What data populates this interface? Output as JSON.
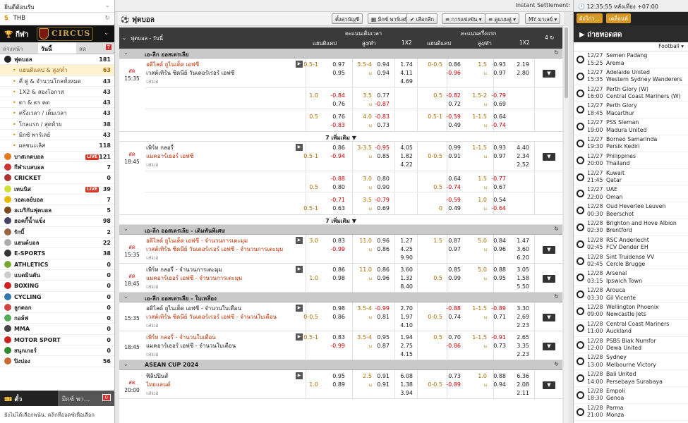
{
  "left": {
    "welcome": "ยินดีต้อนรับ",
    "currency": "THB",
    "sport_title": "กีฬา",
    "logo": "CIRCUS",
    "tabs": [
      {
        "label": "ล่วงหน้า"
      },
      {
        "label": "วันนี้"
      },
      {
        "label": "สด",
        "badge": "7"
      }
    ],
    "sports": [
      {
        "label": "ฟุตบอล",
        "count": "181",
        "color": "#222"
      },
      {
        "label": "แฮนดิแคป & สูง/ต่ำ",
        "count": "63",
        "sub": true,
        "sel": true
      },
      {
        "label": "คี่ คู่ & จำนวนโกลทั้งหมด",
        "count": "43",
        "sub": true
      },
      {
        "label": "1X2 & สองโอกาส",
        "count": "43",
        "sub": true
      },
      {
        "label": "ตา & ตร คด",
        "count": "43",
        "sub": true
      },
      {
        "label": "ครึ่งเวลา / เต็มเวลา",
        "count": "43",
        "sub": true
      },
      {
        "label": "โกลแรก / สุดท้าย",
        "count": "38",
        "sub": true
      },
      {
        "label": "มิกซ์ พาร์เลย์",
        "count": "43",
        "sub": true
      },
      {
        "label": "ผลชนะเลิศ",
        "count": "118",
        "sub": true
      },
      {
        "label": "บาสเกตบอล",
        "count": "121",
        "live": "LIVE",
        "color": "#e07b20"
      },
      {
        "label": "กีฬาเบสบอล",
        "count": "7",
        "color": "#c33"
      },
      {
        "label": "CRICKET",
        "count": "0",
        "color": "#a33"
      },
      {
        "label": "เทนนิส",
        "count": "39",
        "live": "LIVE",
        "color": "#cfe03a"
      },
      {
        "label": "วอลเลย์บอล",
        "count": "7",
        "color": "#e6b800"
      },
      {
        "label": "อเมริกันฟุตบอล",
        "count": "5",
        "color": "#7a4a20"
      },
      {
        "label": "ฮอคกี้น้ำแข็ง",
        "count": "98",
        "color": "#446"
      },
      {
        "label": "รักบี้",
        "count": "2",
        "color": "#964"
      },
      {
        "label": "แฮนด์บอล",
        "count": "22",
        "color": "#aaa"
      },
      {
        "label": "E-SPORTS",
        "count": "38",
        "color": "#333"
      },
      {
        "label": "ATHLETICS",
        "count": "0",
        "color": "#7a3"
      },
      {
        "label": "แบดมินตัน",
        "count": "0",
        "color": "#ccc"
      },
      {
        "label": "BOXING",
        "count": "0",
        "color": "#c22"
      },
      {
        "label": "CYCLING",
        "count": "0",
        "color": "#37a"
      },
      {
        "label": "ลูกดอก",
        "count": "0",
        "color": "#c44"
      },
      {
        "label": "กอล์ฟ",
        "count": "0",
        "color": "#5a5"
      },
      {
        "label": "MMA",
        "count": "0",
        "color": "#444"
      },
      {
        "label": "MOTOR SPORT",
        "count": "0",
        "color": "#c22"
      },
      {
        "label": "สนุกเกอร์",
        "count": "0",
        "color": "#383"
      },
      {
        "label": "ปิงปอง",
        "count": "56",
        "color": "#c63"
      }
    ],
    "bets_tab": "ตั๋ว",
    "mix_tab": "มิกซ์ พา...",
    "mix_badge": "0",
    "hint": "ยังไม่ได้เลือกพนัน. คลิกที่ออดซ์เพื่อเลือก"
  },
  "main": {
    "instant": "Instant Settlement:",
    "title": "ฟุตบอล",
    "tools": [
      "ตั้งค่าบัญชี",
      "มิกซ์ พาร์เลย์",
      "เลือกลีก",
      "การแข่งขัน",
      "ดูแบบคู่",
      "มาเลย์"
    ],
    "head": {
      "left": "ฟุตบอล - วันนี้",
      "full": "คะแนนเต็มเวลา",
      "half": "คะแนนครึ่งแรก",
      "hdp": "แฮนดิแคป",
      "ou": "สูง/ต่ำ",
      "x12": "1X2",
      "count": "4"
    },
    "leagues": [
      {
        "name": "เอ-ลีก ออสเตรเลีย",
        "matches": [
          {
            "live": "สด",
            "time": "15:35",
            "home": "อดิไลด์ ยูไนเต็ด เอฟซี",
            "away": "เวสต์เทิร์น ซิดนีย์ วันเดอร์เรอร์ เอฟซี",
            "draw": "เสมอ",
            "rows": [
              [
                "0.5-1",
                "0.97",
                "3.5-4",
                "0.94",
                "1.74",
                "0-0.5",
                "0.86",
                "1.5",
                "0.93",
                "2.19"
              ],
              [
                "",
                "0.95",
                "u",
                "0.94",
                "4.11",
                "",
                "-0.96",
                "u",
                "0.97",
                "2.80"
              ],
              [
                "",
                "",
                "",
                "",
                "4.69",
                "",
                "",
                "",
                "",
                ""
              ]
            ],
            "alt": [
              [
                "1.0",
                "-0.84",
                "3.5",
                "0.77",
                "",
                "0.5",
                "-0.82",
                "1.5-2",
                "-0.79",
                ""
              ],
              [
                "",
                "0.76",
                "u",
                "-0.87",
                "",
                "",
                "0.72",
                "u",
                "0.69",
                ""
              ],
              [
                "0.5",
                "0.76",
                "4.0",
                "-0.83",
                "",
                "0.5-1",
                "-0.59",
                "1-1.5",
                "0.64",
                ""
              ],
              [
                "",
                "-0.83",
                "u",
                "0.73",
                "",
                "",
                "0.49",
                "u",
                "-0.74",
                ""
              ]
            ],
            "more": "7 เพิ่มเติม"
          },
          {
            "live": "สด",
            "time": "18:45",
            "home": "เพิร์ท กลอรี่",
            "away": "แมคอาร์เธอร์ เอฟซี",
            "draw": "เสมอ",
            "awayfav": true,
            "rows": [
              [
                "",
                "0.86",
                "3-3.5",
                "-0.95",
                "4.05",
                "",
                "0.99",
                "1-1.5",
                "0.93",
                "4.40"
              ],
              [
                "0.5-1",
                "-0.94",
                "u",
                "0.85",
                "1.82",
                "0-0.5",
                "0.91",
                "u",
                "0.97",
                "2.34"
              ],
              [
                "",
                "",
                "",
                "",
                "4.22",
                "",
                "",
                "",
                "",
                "2.52"
              ]
            ],
            "alt": [
              [
                "",
                "-0.88",
                "3.0",
                "0.80",
                "",
                "",
                "0.64",
                "1.5",
                "-0.77",
                ""
              ],
              [
                "0.5",
                "0.80",
                "u",
                "0.90",
                "",
                "0.5",
                "-0.74",
                "u",
                "0.67",
                ""
              ],
              [
                "",
                "-0.71",
                "3.5",
                "-0.79",
                "",
                "",
                "-0.59",
                "1.0",
                "0.54",
                ""
              ],
              [
                "0.5-1",
                "0.63",
                "u",
                "0.69",
                "",
                "0",
                "0.49",
                "u",
                "-0.64",
                ""
              ]
            ],
            "more": "7 เพิ่มเติม"
          }
        ]
      },
      {
        "name": "เอ-ลีก ออสเตรเลีย - เดิมพันพิเศษ",
        "matches": [
          {
            "live": "สด",
            "time": "15:35",
            "home": "อดิไลด์ ยูไนเต็ด เอฟซี - จำนวนการเตะมุม",
            "away": "เวสต์เทิร์น ซิดนีย์ วันเดอร์เรอร์ เอฟซี - จำนวนการเตะมุม",
            "draw": "เสมอ",
            "bothfav": true,
            "rows": [
              [
                "3.0",
                "0.83",
                "11.0",
                "0.96",
                "1.27",
                "1.5",
                "0.87",
                "5.0",
                "0.84",
                "1.47"
              ],
              [
                "",
                "-0.99",
                "u",
                "0.86",
                "4.25",
                "",
                "0.97",
                "u",
                "0.96",
                "3.60"
              ],
              [
                "",
                "",
                "",
                "",
                "9.90",
                "",
                "",
                "",
                "",
                "6.20"
              ]
            ],
            "alt": []
          },
          {
            "live": "สด",
            "time": "18:45",
            "home": "เพิร์ท กลอรี่ - จำนวนการเตะมุม",
            "away": "แมคอาร์เธอร์ เอฟซี - จำนวนการเตะมุม",
            "draw": "เสมอ",
            "awayfav": true,
            "rows": [
              [
                "",
                "0.86",
                "11.0",
                "0.86",
                "3.60",
                "",
                "0.85",
                "5.0",
                "0.88",
                "3.05"
              ],
              [
                "1.0",
                "0.98",
                "u",
                "0.96",
                "1.32",
                "0.5",
                "0.99",
                "u",
                "0.95",
                "1.58"
              ],
              [
                "",
                "",
                "",
                "",
                "8.40",
                "",
                "",
                "",
                "",
                "5.50"
              ]
            ],
            "alt": []
          }
        ]
      },
      {
        "name": "เอ-ลีก ออสเตรเลีย - ใบเหลือง",
        "matches": [
          {
            "live": "",
            "time": "15:35",
            "home": "อดิไลด์ ยูไนเต็ด เอฟซี - จำนวนใบเตือน",
            "away": "เวสต์เทิร์น ซิดนีย์ วันเดอร์เรอร์ เอฟซี - จำนวนใบเตือน",
            "draw": "เสมอ",
            "awayfav": true,
            "rows": [
              [
                "",
                "0.98",
                "3.5-4",
                "-0.99",
                "2.70",
                "",
                "-0.88",
                "1-1.5",
                "-0.89",
                "3.30"
              ],
              [
                "0-0.5",
                "0.86",
                "u",
                "0.81",
                "1.97",
                "0-0.5",
                "0.74",
                "u",
                "0.71",
                "2.69"
              ],
              [
                "",
                "",
                "",
                "",
                "4.10",
                "",
                "",
                "",
                "",
                "2.23"
              ]
            ],
            "alt": []
          },
          {
            "live": "",
            "time": "18:45",
            "home": "เพิร์ท กลอรี่ - จำนวนใบเตือน",
            "away": "แมคอาร์เธอร์ เอฟซี - จำนวนใบเตือน",
            "draw": "เสมอ",
            "homefav": true,
            "rows": [
              [
                "0.5-1",
                "0.83",
                "3.5-4",
                "0.95",
                "1.94",
                "0.5",
                "0.70",
                "1-1.5",
                "-0.91",
                "2.65"
              ],
              [
                "",
                "-0.99",
                "u",
                "0.87",
                "2.75",
                "",
                "-0.86",
                "u",
                "0.73",
                "3.35"
              ],
              [
                "",
                "",
                "",
                "",
                "4.15",
                "",
                "",
                "",
                "",
                "2.23"
              ]
            ],
            "alt": []
          }
        ]
      },
      {
        "name": "ASEAN CUP 2024",
        "matches": [
          {
            "live": "สด",
            "time": "20:00",
            "home": "ฟิลิปปินส์",
            "away": "ไทยแลนด์",
            "draw": "เสมอ",
            "awayfav": true,
            "rows": [
              [
                "",
                "0.95",
                "2.5",
                "0.91",
                "6.08",
                "",
                "0.73",
                "1.0",
                "0.88",
                "6.36"
              ],
              [
                "1.0",
                "0.89",
                "u",
                "0.91",
                "1.38",
                "0-0.5",
                "-0.89",
                "u",
                "0.94",
                "2.08"
              ],
              [
                "",
                "",
                "",
                "",
                "3.94",
                "",
                "",
                "",
                "",
                "2.11"
              ]
            ],
            "alt": []
          }
        ]
      }
    ]
  },
  "right": {
    "clock": "12:35:55 หลังเที่ยง +07:00",
    "btn1": "ผ้อไก่ว...",
    "btn2": "เคล็อนท์",
    "live_title": "ถ่ายทอดสด",
    "filter": "Football",
    "streams": [
      {
        "d": "12/27",
        "t": "15:25",
        "h": "Semen Padang",
        "a": "Arema"
      },
      {
        "d": "12/27",
        "t": "15:35",
        "h": "Adelaide United",
        "a": "Western Sydney Wanderers"
      },
      {
        "d": "12/27",
        "t": "16:00",
        "h": "Perth Glory (W)",
        "a": "Central Coast Mariners (W)"
      },
      {
        "d": "12/27",
        "t": "18:45",
        "h": "Perth Glory",
        "a": "Macarthur"
      },
      {
        "d": "12/27",
        "t": "19:00",
        "h": "PSS Sleman",
        "a": "Madura United"
      },
      {
        "d": "12/27",
        "t": "19:30",
        "h": "Borneo Samarinda",
        "a": "Persik Kediri"
      },
      {
        "d": "12/27",
        "t": "20:00",
        "h": "Philippines",
        "a": "Thailand"
      },
      {
        "d": "12/27",
        "t": "21:45",
        "h": "Kuwait",
        "a": "Qatar"
      },
      {
        "d": "12/27",
        "t": "22:00",
        "h": "UAE",
        "a": "Oman"
      },
      {
        "d": "12/28",
        "t": "00:30",
        "h": "Oud Heverlee Leuven",
        "a": "Beerschot"
      },
      {
        "d": "12/28",
        "t": "02:30",
        "h": "Brighton and Hove Albion",
        "a": "Brentford"
      },
      {
        "d": "12/28",
        "t": "02:45",
        "h": "RSC Anderlecht",
        "a": "FCV Dender EH"
      },
      {
        "d": "12/28",
        "t": "02:45",
        "h": "Sint Truidense VV",
        "a": "Cercle Brugge"
      },
      {
        "d": "12/28",
        "t": "03:15",
        "h": "Arsenal",
        "a": "Ipswich Town"
      },
      {
        "d": "12/28",
        "t": "03:30",
        "h": "Arouca",
        "a": "Gil Vicente"
      },
      {
        "d": "12/28",
        "t": "09:00",
        "h": "Wellington Phoenix",
        "a": "Newcastle Jets"
      },
      {
        "d": "12/28",
        "t": "11:00",
        "h": "Central Coast Mariners",
        "a": "Auckland"
      },
      {
        "d": "12/28",
        "t": "12:00",
        "h": "PSBS Biak Numfor",
        "a": "Dewa United"
      },
      {
        "d": "12/28",
        "t": "13:00",
        "h": "Sydney",
        "a": "Melbourne Victory"
      },
      {
        "d": "12/28",
        "t": "14:00",
        "h": "Bali United",
        "a": "Persebaya Surabaya"
      },
      {
        "d": "12/28",
        "t": "18:30",
        "h": "Empoli",
        "a": "Genoa"
      },
      {
        "d": "12/28",
        "t": "21:00",
        "h": "Parma",
        "a": "Monza"
      }
    ]
  }
}
